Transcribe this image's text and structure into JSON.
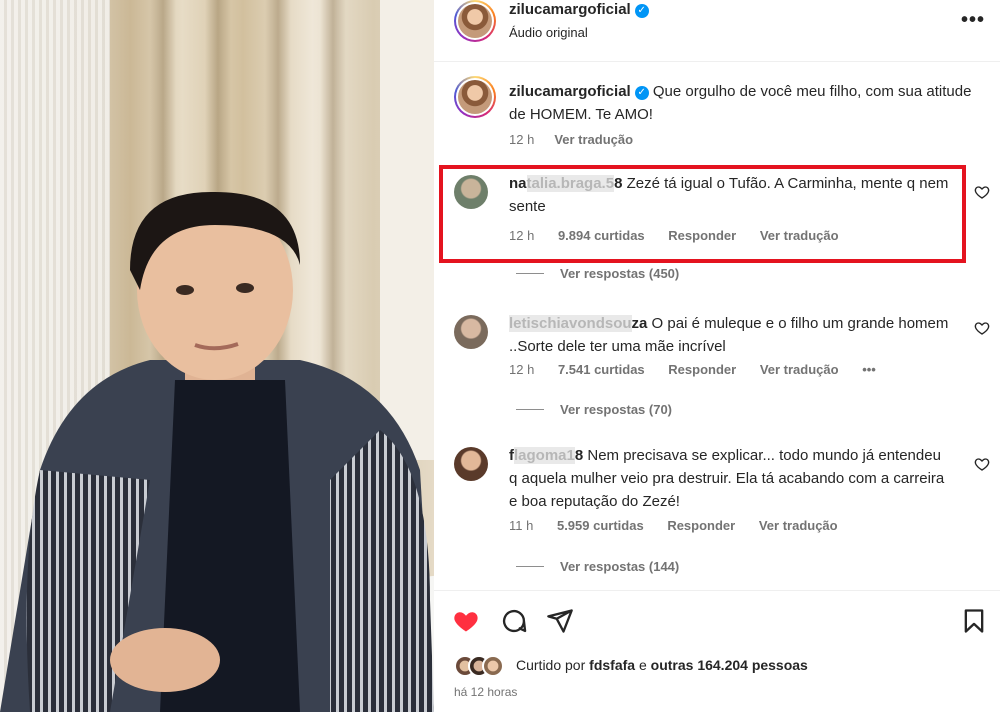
{
  "post_header": {
    "username": "zilucamargoficial",
    "audio_label": "Áudio original",
    "more_icon": "more-horizontal-icon"
  },
  "caption": {
    "username": "zilucamargoficial",
    "text": "Que orgulho de você meu filho, com sua atitude de HOMEM. Te AMO!",
    "time": "12 h",
    "translate": "Ver tradução"
  },
  "comments": [
    {
      "username_visible_prefix": "na",
      "username_masked": "talia.braga.5",
      "username_visible_suffix": "8",
      "text": "Zezé tá igual o Tufão. A Carminha, mente q nem sente",
      "time": "12 h",
      "likes": "9.894 curtidas",
      "reply": "Responder",
      "translate": "Ver tradução",
      "view_replies": "Ver respostas (450)",
      "highlighted": true
    },
    {
      "username_visible_prefix": "",
      "username_masked": "letischiavondsou",
      "username_visible_suffix": "za",
      "text": "O pai é muleque e o filho um grande homem ..Sorte dele ter uma mãe incrível",
      "time": "12 h",
      "likes": "7.541 curtidas",
      "reply": "Responder",
      "translate": "Ver tradução",
      "more": "•••",
      "view_replies": "Ver respostas (70)"
    },
    {
      "username_visible_prefix": "f",
      "username_masked": "lagoma1",
      "username_visible_suffix": "8",
      "text": "Nem precisava se explicar... todo mundo já entendeu q aquela mulher veio pra destruir. Ela tá acabando com a carreira e boa reputação do Zezé!",
      "time": "11 h",
      "likes": "5.959 curtidas",
      "reply": "Responder",
      "translate": "Ver tradução",
      "view_replies": "Ver respostas (144)"
    }
  ],
  "actions": {
    "like_icon": "heart-filled-icon",
    "comment_icon": "comment-icon",
    "share_icon": "share-icon",
    "save_icon": "bookmark-icon",
    "like_color": "#ff3040"
  },
  "likes": {
    "prefix": "Curtido por",
    "user": "fdsfafa",
    "middle": "e",
    "others": "outras 164.204 pessoas"
  },
  "posted": "há 12 horas",
  "colors": {
    "highlight_border": "#e4131f",
    "verified": "#0095f6",
    "meta_text": "#737373"
  }
}
